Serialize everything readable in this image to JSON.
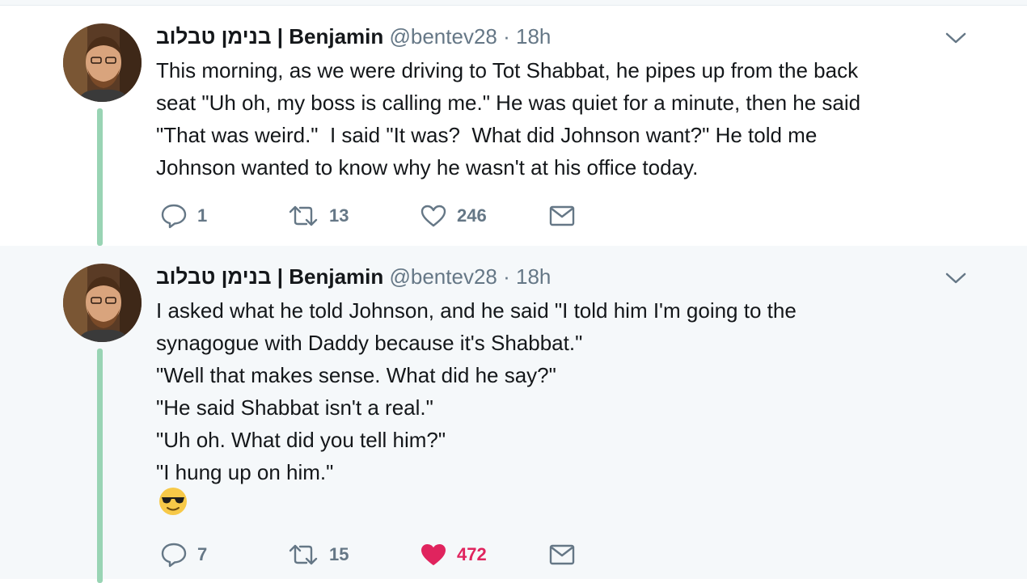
{
  "tweets": [
    {
      "author_name": "בנימן טבלוב | Benjamin",
      "handle": "@bentev28",
      "separator": "·",
      "time": "18h",
      "lines": [
        "This morning, as we were driving to Tot Shabbat, he pipes up from the back",
        "seat \"Uh oh, my boss is calling me.\" He was quiet for a minute, then he said",
        "\"That was weird.\"  I said \"It was?  What did Johnson want?\" He told me",
        "Johnson wanted to know why he wasn't at his office today."
      ],
      "replies": "1",
      "retweets": "13",
      "likes": "246",
      "liked": false
    },
    {
      "author_name": "בנימן טבלוב | Benjamin",
      "handle": "@bentev28",
      "separator": "·",
      "time": "18h",
      "lines": [
        "I asked what he told Johnson, and he said \"I told him I'm going to the",
        "synagogue with Daddy because it's Shabbat.\"",
        "\"Well that makes sense. What did he say?\"",
        "\"He said Shabbat isn't a real.\"",
        "\"Uh oh. What did you tell him?\"",
        "\"I hung up on him.\""
      ],
      "emoji": "smiling-face-with-sunglasses",
      "replies": "7",
      "retweets": "15",
      "likes": "472",
      "liked": true
    }
  ],
  "colors": {
    "thread_line": "#99d4b4",
    "secondary_text": "#657786",
    "like_active": "#e0245e",
    "reply_background": "#f5f8fa"
  },
  "icons": {
    "reply": "reply-icon",
    "retweet": "retweet-icon",
    "like": "heart-icon",
    "dm": "envelope-icon",
    "caret": "chevron-down-icon"
  }
}
